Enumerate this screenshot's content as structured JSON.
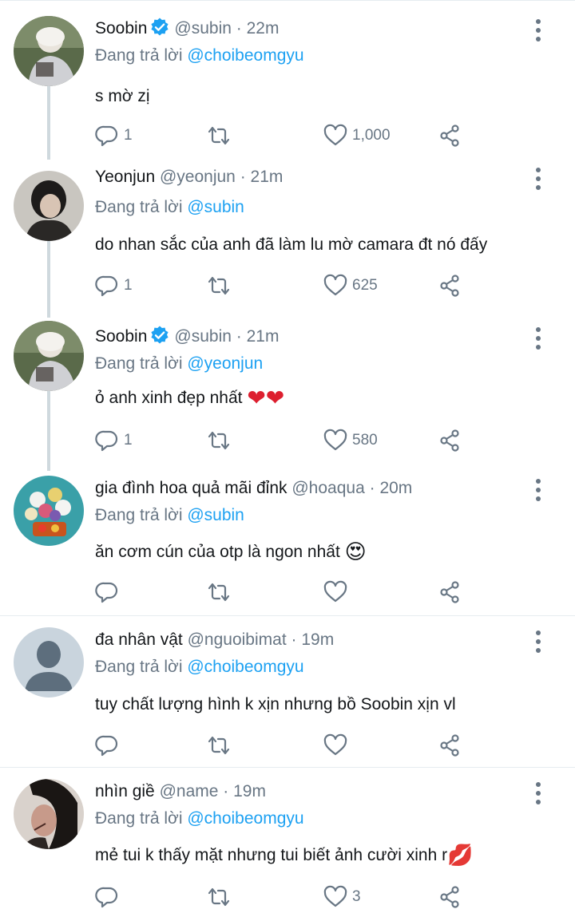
{
  "replying_prefix": "Đang trả lời",
  "tweets": [
    {
      "name": "Soobin",
      "handle": "@subin",
      "time": "22m",
      "verified": true,
      "reply_to": "@choibeomgyu",
      "text": "s mờ zị",
      "replies": "1",
      "retweets": "",
      "likes": "1,000",
      "avatar_icon": "photo-avatar"
    },
    {
      "name": "Yeonjun",
      "handle": "@yeonjun",
      "time": "21m",
      "verified": false,
      "reply_to": "@subin",
      "text": "do nhan sắc của anh đã làm lu mờ camara đt nó đấy",
      "replies": "1",
      "retweets": "",
      "likes": "625",
      "avatar_icon": "photo-avatar"
    },
    {
      "name": "Soobin",
      "handle": "@subin",
      "time": "21m",
      "verified": true,
      "reply_to": "@yeonjun",
      "text": "ỏ anh xinh đẹp nhất",
      "emoji": "❤❤",
      "replies": "1",
      "retweets": "",
      "likes": "580",
      "avatar_icon": "photo-avatar"
    },
    {
      "name": "gia đình hoa quả mãi đỉnk",
      "handle": "@hoaqua",
      "time": "20m",
      "verified": false,
      "reply_to": "@subin",
      "text": "ăn cơm cún của otp là ngon nhất",
      "emoji": "😍",
      "replies": "",
      "retweets": "",
      "likes": "",
      "avatar_icon": "photo-avatar"
    },
    {
      "name": "đa nhân vật",
      "handle": "@nguoibimat",
      "time": "19m",
      "verified": false,
      "reply_to": "@choibeomgyu",
      "text": "tuy chất lượng hình k xịn nhưng bồ Soobin xịn vl",
      "replies": "",
      "retweets": "",
      "likes": "",
      "avatar_icon": "default-avatar"
    },
    {
      "name": "nhìn giề",
      "handle": "@name",
      "time": "19m",
      "verified": false,
      "reply_to": "@choibeomgyu",
      "text": "mẻ tui k thấy mặt nhưng tui biết ảnh cười xinh r",
      "emoji": "💋",
      "replies": "",
      "retweets": "",
      "likes": "3",
      "avatar_icon": "photo-avatar"
    }
  ],
  "colors": {
    "accent": "#1da1f2",
    "secondary_text": "#687684",
    "primary_text": "#14171a",
    "thread_line": "#cfd9de",
    "divider": "#e6ecf0"
  },
  "icons": {
    "reply": "reply-icon",
    "retweet": "retweet-icon",
    "like": "heart-icon",
    "share": "share-icon",
    "menu": "more-options-icon",
    "verified": "verified-badge-icon"
  }
}
